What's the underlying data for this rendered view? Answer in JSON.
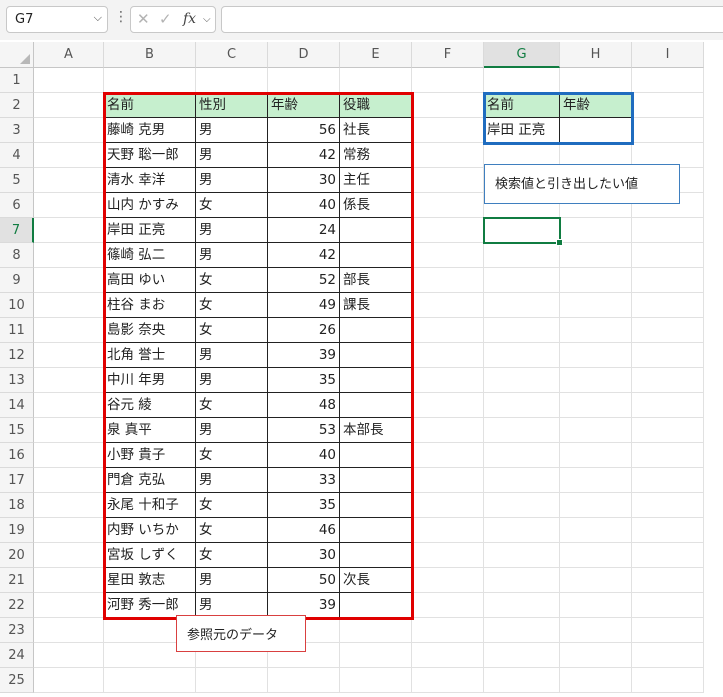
{
  "name_box": "G7",
  "fx_label": "fx",
  "columns": [
    "A",
    "B",
    "C",
    "D",
    "E",
    "F",
    "G",
    "H",
    "I"
  ],
  "active_column": "G",
  "rows": [
    "1",
    "2",
    "3",
    "4",
    "5",
    "6",
    "7",
    "8",
    "9",
    "10",
    "11",
    "12",
    "13",
    "14",
    "15",
    "16",
    "17",
    "18",
    "19",
    "20",
    "21",
    "22",
    "23",
    "24",
    "25"
  ],
  "active_row": "7",
  "source_table": {
    "headers": [
      "名前",
      "性別",
      "年齢",
      "役職"
    ],
    "rows": [
      [
        "藤崎 克男",
        "男",
        "56",
        "社長"
      ],
      [
        "天野 聡一郎",
        "男",
        "42",
        "常務"
      ],
      [
        "清水 幸洋",
        "男",
        "30",
        "主任"
      ],
      [
        "山内 かすみ",
        "女",
        "40",
        "係長"
      ],
      [
        "岸田 正亮",
        "男",
        "24",
        ""
      ],
      [
        "篠崎 弘二",
        "男",
        "42",
        ""
      ],
      [
        "高田 ゆい",
        "女",
        "52",
        "部長"
      ],
      [
        "柱谷 まお",
        "女",
        "49",
        "課長"
      ],
      [
        "島影 奈央",
        "女",
        "26",
        ""
      ],
      [
        "北角 誉士",
        "男",
        "39",
        ""
      ],
      [
        "中川 年男",
        "男",
        "35",
        ""
      ],
      [
        "谷元 綾",
        "女",
        "48",
        ""
      ],
      [
        "泉 真平",
        "男",
        "53",
        "本部長"
      ],
      [
        "小野 貴子",
        "女",
        "40",
        ""
      ],
      [
        "門倉 克弘",
        "男",
        "33",
        ""
      ],
      [
        "永尾 十和子",
        "女",
        "35",
        ""
      ],
      [
        "内野 いちか",
        "女",
        "46",
        ""
      ],
      [
        "宮坂 しずく",
        "女",
        "30",
        ""
      ],
      [
        "星田 敦志",
        "男",
        "50",
        "次長"
      ],
      [
        "河野 秀一郎",
        "男",
        "39",
        ""
      ]
    ]
  },
  "lookup_table": {
    "headers": [
      "名前",
      "年齢"
    ],
    "row": [
      "岸田 正亮",
      ""
    ]
  },
  "notes": {
    "lookup_note": "検索値と引き出したい値",
    "source_note": "参照元のデータ"
  },
  "colors": {
    "header_fill": "#c6efce",
    "source_border": "#e00000",
    "lookup_border": "#1f6cbf",
    "selection": "#107c41"
  }
}
